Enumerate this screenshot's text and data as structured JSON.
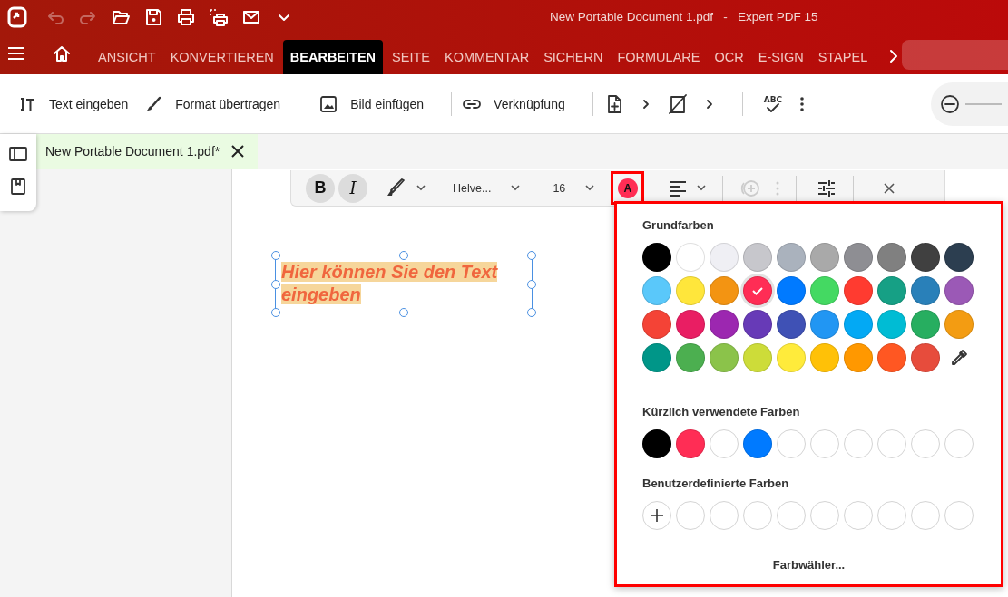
{
  "window": {
    "title": "New Portable Document 1.pdf   -   Expert PDF 15"
  },
  "quick_access": [
    {
      "kind": "undo",
      "disabled": true
    },
    {
      "kind": "redo",
      "disabled": true
    },
    {
      "kind": "open",
      "disabled": false
    },
    {
      "kind": "save",
      "disabled": false
    },
    {
      "kind": "print",
      "disabled": false
    },
    {
      "kind": "print-area",
      "disabled": false
    },
    {
      "kind": "mail",
      "disabled": false
    },
    {
      "kind": "more",
      "disabled": false
    }
  ],
  "ribbon_tabs": [
    {
      "label": "ANSICHT",
      "selected": false
    },
    {
      "label": "KONVERTIEREN",
      "selected": false
    },
    {
      "label": "BEARBEITEN",
      "selected": true
    },
    {
      "label": "SEITE",
      "selected": false
    },
    {
      "label": "KOMMENTAR",
      "selected": false
    },
    {
      "label": "SICHERN",
      "selected": false
    },
    {
      "label": "FORMULARE",
      "selected": false
    },
    {
      "label": "OCR",
      "selected": false
    },
    {
      "label": "E-SIGN",
      "selected": false
    },
    {
      "label": "STAPEL",
      "selected": false
    }
  ],
  "toolbar": {
    "tools": [
      {
        "kind": "text",
        "label": "Text eingeben"
      },
      {
        "kind": "brush",
        "label": "Format übertragen"
      },
      {
        "kind": "image",
        "label": "Bild einfügen"
      },
      {
        "kind": "link",
        "label": "Verknüpfung"
      }
    ],
    "spellcheck_label": "ABC"
  },
  "document_tab": {
    "title": "New Portable Document 1.pdf*"
  },
  "format_bar": {
    "bold_label": "B",
    "bold": true,
    "italic_label": "I",
    "italic": true,
    "font": "Helve...",
    "size": "16",
    "color_label": "A",
    "color": "#ff2d55"
  },
  "text_box": {
    "text": "Hier können Sie den Text eingeben"
  },
  "color_popup": {
    "basic_title": "Grundfarben",
    "basic": [
      {
        "color": "#000000",
        "selected": false
      },
      {
        "color": "#ffffff",
        "selected": false
      },
      {
        "color": "#efeff4",
        "selected": false
      },
      {
        "color": "#c7c7cc",
        "selected": false
      },
      {
        "color": "#aab2bd",
        "selected": false
      },
      {
        "color": "#a9a9a9",
        "selected": false
      },
      {
        "color": "#8e8e93",
        "selected": false
      },
      {
        "color": "#808080",
        "selected": false
      },
      {
        "color": "#404040",
        "selected": false
      },
      {
        "color": "#2c3e50",
        "selected": false
      },
      {
        "color": "#5ac8fa",
        "selected": false
      },
      {
        "color": "#ffe63b",
        "selected": false
      },
      {
        "color": "#f39412",
        "selected": false
      },
      {
        "color": "#ff2d55",
        "selected": true
      },
      {
        "color": "#007aff",
        "selected": false
      },
      {
        "color": "#44d962",
        "selected": false
      },
      {
        "color": "#ff3b30",
        "selected": false
      },
      {
        "color": "#16a085",
        "selected": false
      },
      {
        "color": "#2980b9",
        "selected": false
      },
      {
        "color": "#9b59b6",
        "selected": false
      },
      {
        "color": "#f44336",
        "selected": false
      },
      {
        "color": "#e91e63",
        "selected": false
      },
      {
        "color": "#9c27b0",
        "selected": false
      },
      {
        "color": "#673ab7",
        "selected": false
      },
      {
        "color": "#3f51b5",
        "selected": false
      },
      {
        "color": "#2196f3",
        "selected": false
      },
      {
        "color": "#03a9f4",
        "selected": false
      },
      {
        "color": "#00bcd4",
        "selected": false
      },
      {
        "color": "#27ae60",
        "selected": false
      },
      {
        "color": "#f39c12",
        "selected": false
      },
      {
        "color": "#009688",
        "selected": false
      },
      {
        "color": "#4caf50",
        "selected": false
      },
      {
        "color": "#8bc34a",
        "selected": false
      },
      {
        "color": "#cddc39",
        "selected": false
      },
      {
        "color": "#ffeb3b",
        "selected": false
      },
      {
        "color": "#ffc107",
        "selected": false
      },
      {
        "color": "#ff9800",
        "selected": false
      },
      {
        "color": "#ff5722",
        "selected": false
      },
      {
        "color": "#e74c3c",
        "selected": false
      }
    ],
    "recent_title": "Kürzlich verwendete Farben",
    "recent": [
      {
        "kind": "swatch",
        "color": "#000000"
      },
      {
        "kind": "swatch",
        "color": "#ff2d55"
      },
      {
        "kind": "empty"
      },
      {
        "kind": "swatch",
        "color": "#007aff"
      },
      {
        "kind": "empty"
      },
      {
        "kind": "empty"
      },
      {
        "kind": "empty"
      },
      {
        "kind": "empty"
      },
      {
        "kind": "empty"
      },
      {
        "kind": "empty"
      }
    ],
    "custom_title": "Benutzerdefinierte Farben",
    "custom": [
      {
        "kind": "add"
      },
      {
        "kind": "empty"
      },
      {
        "kind": "empty"
      },
      {
        "kind": "empty"
      },
      {
        "kind": "empty"
      },
      {
        "kind": "empty"
      },
      {
        "kind": "empty"
      },
      {
        "kind": "empty"
      },
      {
        "kind": "empty"
      },
      {
        "kind": "empty"
      }
    ],
    "picker_label": "Farbwähler..."
  }
}
